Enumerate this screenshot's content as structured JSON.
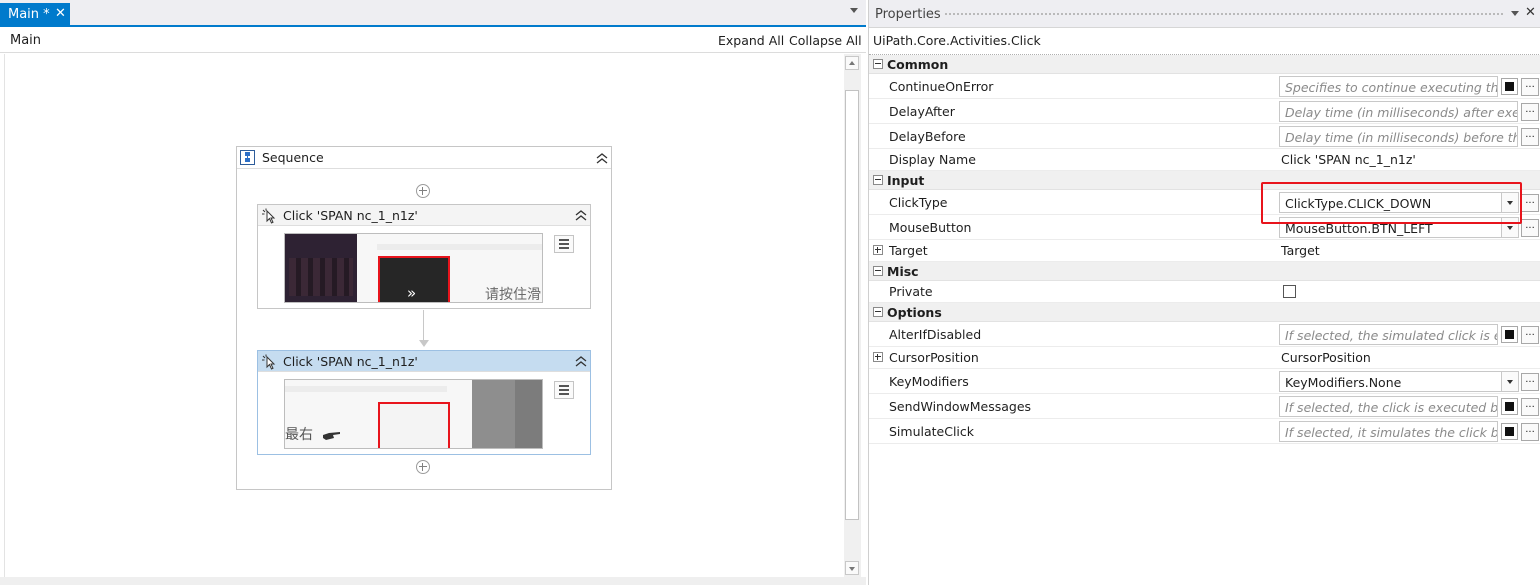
{
  "designer": {
    "tab_label": "Main *",
    "tab_close": "✕",
    "breadcrumb": "Main",
    "expand_all": "Expand All",
    "collapse_all": "Collapse All",
    "sequence": {
      "title": "Sequence",
      "activities": [
        {
          "title": "Click 'SPAN  nc_1_n1z'",
          "preview_text": "请按住滑",
          "preview_glyph": "»"
        },
        {
          "title": "Click 'SPAN  nc_1_n1z'",
          "preview_text": "最右"
        }
      ]
    }
  },
  "properties": {
    "panel_title": "Properties",
    "close": "✕",
    "type_name": "UiPath.Core.Activities.Click",
    "categories": {
      "common": {
        "label": "Common",
        "rows": {
          "continue_on_error": {
            "name": "ContinueOnError",
            "hint": "Specifies to continue executing the r"
          },
          "delay_after": {
            "name": "DelayAfter",
            "hint": "Delay time (in milliseconds) after execut"
          },
          "delay_before": {
            "name": "DelayBefore",
            "hint": "Delay time (in milliseconds) before the a"
          },
          "display_name": {
            "name": "Display Name",
            "value": "Click 'SPAN  nc_1_n1z'"
          }
        }
      },
      "input": {
        "label": "Input",
        "rows": {
          "click_type": {
            "name": "ClickType",
            "value": "ClickType.CLICK_DOWN"
          },
          "mouse_button": {
            "name": "MouseButton",
            "value": "MouseButton.BTN_LEFT"
          },
          "target": {
            "name": "Target",
            "value": "Target"
          }
        }
      },
      "misc": {
        "label": "Misc",
        "rows": {
          "private": {
            "name": "Private",
            "checked": false
          }
        }
      },
      "options": {
        "label": "Options",
        "rows": {
          "alter_if_disabled": {
            "name": "AlterIfDisabled",
            "hint": "If selected, the simulated click is exe"
          },
          "cursor_position": {
            "name": "CursorPosition",
            "value": "CursorPosition"
          },
          "key_modifiers": {
            "name": "KeyModifiers",
            "value": "KeyModifiers.None"
          },
          "send_window_messages": {
            "name": "SendWindowMessages",
            "hint": "If selected, the click is executed by se"
          },
          "simulate_click": {
            "name": "SimulateClick",
            "hint": "If selected, it simulates the click by u"
          }
        }
      }
    },
    "ellipsis": "...",
    "highlight_color": "#e8141c"
  }
}
